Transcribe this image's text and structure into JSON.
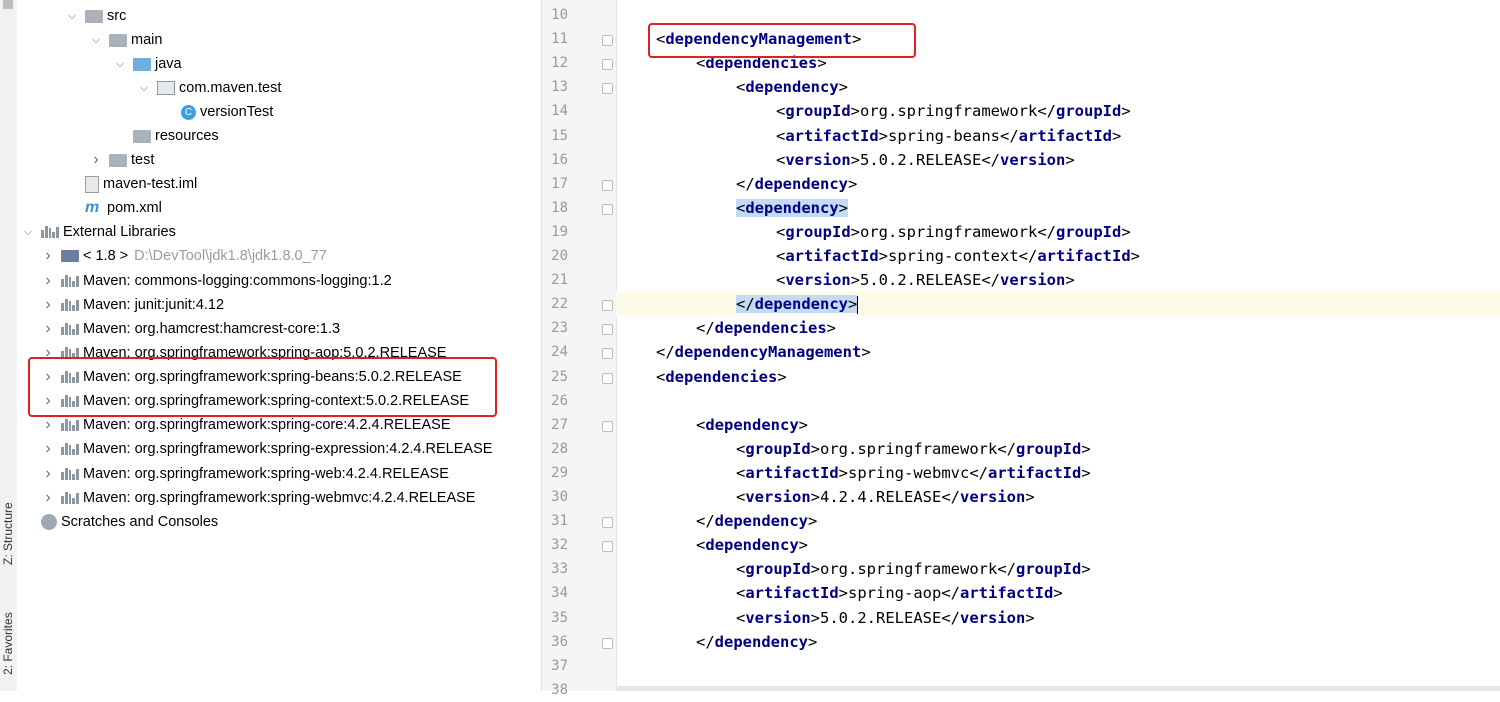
{
  "side_tabs": [
    "Z: Structure",
    "2: Favorites"
  ],
  "tree": [
    {
      "label": "src",
      "icon": "folder-icon",
      "expanded": true,
      "level": 2
    },
    {
      "label": "main",
      "icon": "folder-icon",
      "expanded": true,
      "level": 3
    },
    {
      "label": "java",
      "icon": "source-folder-icon",
      "expanded": true,
      "level": 4
    },
    {
      "label": "com.maven.test",
      "icon": "package-icon",
      "expanded": true,
      "level": 5
    },
    {
      "label": "versionTest",
      "icon": "class-icon",
      "level": 6
    },
    {
      "label": "resources",
      "icon": "resources-folder-icon",
      "level": 4
    },
    {
      "label": "test",
      "icon": "folder-icon",
      "expanded": false,
      "level": 3
    },
    {
      "label": "maven-test.iml",
      "icon": "iml-file-icon",
      "level": 2
    },
    {
      "label": "pom.xml",
      "icon": "maven-pom-icon",
      "level": 2
    },
    {
      "label": "External Libraries",
      "icon": "libraries-icon",
      "expanded": true,
      "level": 0
    },
    {
      "label": "< 1.8 >",
      "extra": "D:\\DevTool\\jdk1.8\\jdk1.8.0_77",
      "icon": "jdk-icon",
      "expanded": false,
      "level": 1
    },
    {
      "label": "Maven: commons-logging:commons-logging:1.2",
      "icon": "library-icon",
      "expanded": false,
      "level": 1
    },
    {
      "label": "Maven: junit:junit:4.12",
      "icon": "library-icon",
      "expanded": false,
      "level": 1
    },
    {
      "label": "Maven: org.hamcrest:hamcrest-core:1.3",
      "icon": "library-icon",
      "expanded": false,
      "level": 1
    },
    {
      "label": "Maven: org.springframework:spring-aop:5.0.2.RELEASE",
      "icon": "library-icon",
      "expanded": false,
      "level": 1
    },
    {
      "label": "Maven: org.springframework:spring-beans:5.0.2.RELEASE",
      "icon": "library-icon",
      "expanded": false,
      "level": 1
    },
    {
      "label": "Maven: org.springframework:spring-context:5.0.2.RELEASE",
      "icon": "library-icon",
      "expanded": false,
      "level": 1
    },
    {
      "label": "Maven: org.springframework:spring-core:4.2.4.RELEASE",
      "icon": "library-icon",
      "expanded": false,
      "level": 1
    },
    {
      "label": "Maven: org.springframework:spring-expression:4.2.4.RELEASE",
      "icon": "library-icon",
      "expanded": false,
      "level": 1
    },
    {
      "label": "Maven: org.springframework:spring-web:4.2.4.RELEASE",
      "icon": "library-icon",
      "expanded": false,
      "level": 1
    },
    {
      "label": "Maven: org.springframework:spring-webmvc:4.2.4.RELEASE",
      "icon": "library-icon",
      "expanded": false,
      "level": 1
    },
    {
      "label": "Scratches and Consoles",
      "icon": "scratches-icon",
      "level": 0
    }
  ],
  "editor": {
    "lines": [
      {
        "n": "10",
        "indent": 0,
        "parts": []
      },
      {
        "n": "11",
        "indent": 1,
        "parts": [
          [
            "t",
            "<"
          ],
          [
            "g",
            "dependencyManagement"
          ],
          [
            "t",
            ">"
          ]
        ]
      },
      {
        "n": "12",
        "indent": 2,
        "parts": [
          [
            "t",
            "<"
          ],
          [
            "g",
            "dependencies"
          ],
          [
            "t",
            ">"
          ]
        ]
      },
      {
        "n": "13",
        "indent": 3,
        "parts": [
          [
            "t",
            "<"
          ],
          [
            "g",
            "dependency"
          ],
          [
            "t",
            ">"
          ]
        ]
      },
      {
        "n": "14",
        "indent": 4,
        "parts": [
          [
            "t",
            "<"
          ],
          [
            "g",
            "groupId"
          ],
          [
            "t",
            ">"
          ],
          [
            "v",
            "org.springframework"
          ],
          [
            "t",
            "</"
          ],
          [
            "g",
            "groupId"
          ],
          [
            "t",
            ">"
          ]
        ]
      },
      {
        "n": "15",
        "indent": 4,
        "parts": [
          [
            "t",
            "<"
          ],
          [
            "g",
            "artifactId"
          ],
          [
            "t",
            ">"
          ],
          [
            "v",
            "spring-beans"
          ],
          [
            "t",
            "</"
          ],
          [
            "g",
            "artifactId"
          ],
          [
            "t",
            ">"
          ]
        ]
      },
      {
        "n": "16",
        "indent": 4,
        "parts": [
          [
            "t",
            "<"
          ],
          [
            "g",
            "version"
          ],
          [
            "t",
            ">"
          ],
          [
            "v",
            "5.0.2.RELEASE"
          ],
          [
            "t",
            "</"
          ],
          [
            "g",
            "version"
          ],
          [
            "t",
            ">"
          ]
        ]
      },
      {
        "n": "17",
        "indent": 3,
        "parts": [
          [
            "t",
            "</"
          ],
          [
            "g",
            "dependency"
          ],
          [
            "t",
            ">"
          ]
        ]
      },
      {
        "n": "18",
        "indent": 3,
        "sel": true,
        "parts": [
          [
            "t",
            "<"
          ],
          [
            "g",
            "dependency"
          ],
          [
            "t",
            ">"
          ]
        ]
      },
      {
        "n": "19",
        "indent": 4,
        "parts": [
          [
            "t",
            "<"
          ],
          [
            "g",
            "groupId"
          ],
          [
            "t",
            ">"
          ],
          [
            "v",
            "org.springframework"
          ],
          [
            "t",
            "</"
          ],
          [
            "g",
            "groupId"
          ],
          [
            "t",
            ">"
          ]
        ]
      },
      {
        "n": "20",
        "indent": 4,
        "parts": [
          [
            "t",
            "<"
          ],
          [
            "g",
            "artifactId"
          ],
          [
            "t",
            ">"
          ],
          [
            "v",
            "spring-context"
          ],
          [
            "t",
            "</"
          ],
          [
            "g",
            "artifactId"
          ],
          [
            "t",
            ">"
          ]
        ]
      },
      {
        "n": "21",
        "indent": 4,
        "parts": [
          [
            "t",
            "<"
          ],
          [
            "g",
            "version"
          ],
          [
            "t",
            ">"
          ],
          [
            "v",
            "5.0.2.RELEASE"
          ],
          [
            "t",
            "</"
          ],
          [
            "g",
            "version"
          ],
          [
            "t",
            ">"
          ]
        ]
      },
      {
        "n": "22",
        "indent": 3,
        "sel": true,
        "caret": true,
        "parts": [
          [
            "t",
            "</"
          ],
          [
            "g",
            "dependency"
          ],
          [
            "t",
            ">"
          ]
        ]
      },
      {
        "n": "23",
        "indent": 2,
        "parts": [
          [
            "t",
            "</"
          ],
          [
            "g",
            "dependencies"
          ],
          [
            "t",
            ">"
          ]
        ]
      },
      {
        "n": "24",
        "indent": 1,
        "parts": [
          [
            "t",
            "</"
          ],
          [
            "g",
            "dependencyManagement"
          ],
          [
            "t",
            ">"
          ]
        ]
      },
      {
        "n": "25",
        "indent": 1,
        "parts": [
          [
            "t",
            "<"
          ],
          [
            "g",
            "dependencies"
          ],
          [
            "t",
            ">"
          ]
        ]
      },
      {
        "n": "26",
        "indent": 0,
        "parts": []
      },
      {
        "n": "27",
        "indent": 2,
        "parts": [
          [
            "t",
            "<"
          ],
          [
            "g",
            "dependency"
          ],
          [
            "t",
            ">"
          ]
        ]
      },
      {
        "n": "28",
        "indent": 3,
        "parts": [
          [
            "t",
            "<"
          ],
          [
            "g",
            "groupId"
          ],
          [
            "t",
            ">"
          ],
          [
            "v",
            "org.springframework"
          ],
          [
            "t",
            "</"
          ],
          [
            "g",
            "groupId"
          ],
          [
            "t",
            ">"
          ]
        ]
      },
      {
        "n": "29",
        "indent": 3,
        "parts": [
          [
            "t",
            "<"
          ],
          [
            "g",
            "artifactId"
          ],
          [
            "t",
            ">"
          ],
          [
            "v",
            "spring-webmvc"
          ],
          [
            "t",
            "</"
          ],
          [
            "g",
            "artifactId"
          ],
          [
            "t",
            ">"
          ]
        ]
      },
      {
        "n": "30",
        "indent": 3,
        "parts": [
          [
            "t",
            "<"
          ],
          [
            "g",
            "version"
          ],
          [
            "t",
            ">"
          ],
          [
            "v",
            "4.2.4.RELEASE"
          ],
          [
            "t",
            "</"
          ],
          [
            "g",
            "version"
          ],
          [
            "t",
            ">"
          ]
        ]
      },
      {
        "n": "31",
        "indent": 2,
        "parts": [
          [
            "t",
            "</"
          ],
          [
            "g",
            "dependency"
          ],
          [
            "t",
            ">"
          ]
        ]
      },
      {
        "n": "32",
        "indent": 2,
        "parts": [
          [
            "t",
            "<"
          ],
          [
            "g",
            "dependency"
          ],
          [
            "t",
            ">"
          ]
        ]
      },
      {
        "n": "33",
        "indent": 3,
        "parts": [
          [
            "t",
            "<"
          ],
          [
            "g",
            "groupId"
          ],
          [
            "t",
            ">"
          ],
          [
            "v",
            "org.springframework"
          ],
          [
            "t",
            "</"
          ],
          [
            "g",
            "groupId"
          ],
          [
            "t",
            ">"
          ]
        ]
      },
      {
        "n": "34",
        "indent": 3,
        "parts": [
          [
            "t",
            "<"
          ],
          [
            "g",
            "artifactId"
          ],
          [
            "t",
            ">"
          ],
          [
            "v",
            "spring-aop"
          ],
          [
            "t",
            "</"
          ],
          [
            "g",
            "artifactId"
          ],
          [
            "t",
            ">"
          ]
        ]
      },
      {
        "n": "35",
        "indent": 3,
        "parts": [
          [
            "t",
            "<"
          ],
          [
            "g",
            "version"
          ],
          [
            "t",
            ">"
          ],
          [
            "v",
            "5.0.2.RELEASE"
          ],
          [
            "t",
            "</"
          ],
          [
            "g",
            "version"
          ],
          [
            "t",
            ">"
          ]
        ]
      },
      {
        "n": "36",
        "indent": 2,
        "parts": [
          [
            "t",
            "</"
          ],
          [
            "g",
            "dependency"
          ],
          [
            "t",
            ">"
          ]
        ]
      },
      {
        "n": "37",
        "indent": 0,
        "parts": []
      },
      {
        "n": "38",
        "indent": 0,
        "parts": []
      }
    ]
  },
  "colors": {
    "highlight_box": "#e0201f",
    "xml_tag": "#000080",
    "selection": "#c3dbf5",
    "current_line": "#fdfbe7"
  }
}
